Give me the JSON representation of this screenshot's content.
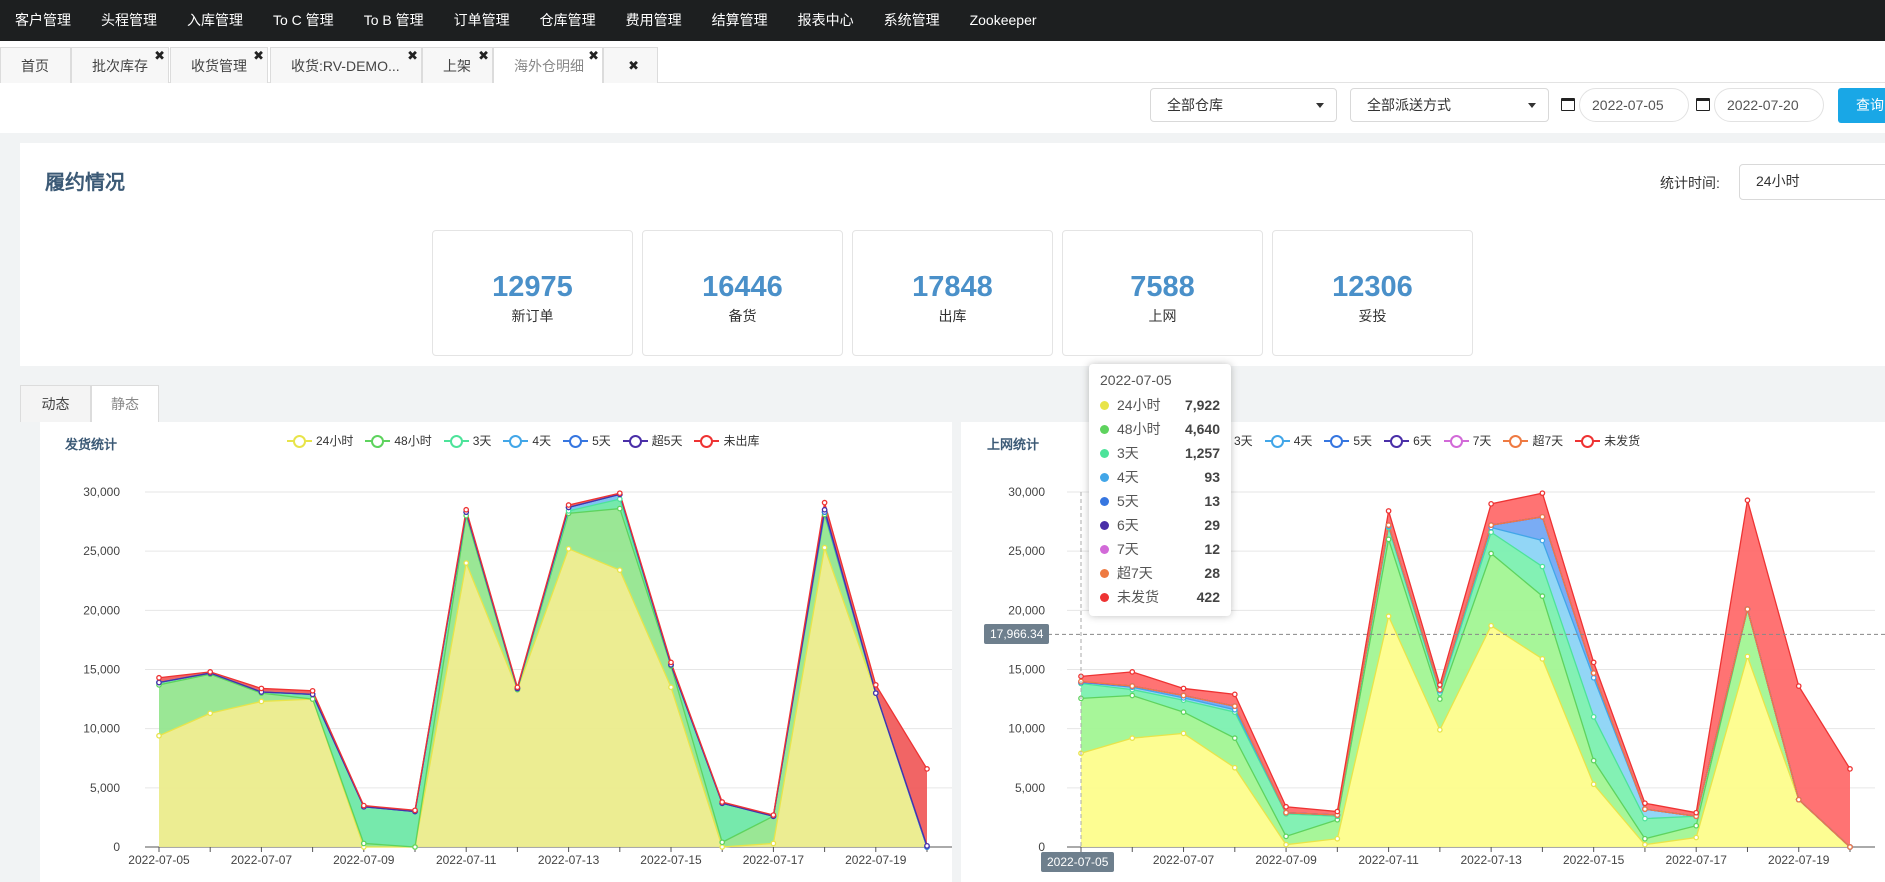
{
  "nav": {
    "items": [
      "客户管理",
      "头程管理",
      "入库管理",
      "To C 管理",
      "To B 管理",
      "订单管理",
      "仓库管理",
      "费用管理",
      "结算管理",
      "报表中心",
      "系统管理",
      "Zookeeper"
    ]
  },
  "tabs": [
    {
      "label": "首页",
      "closable": false
    },
    {
      "label": "批次库存",
      "closable": true
    },
    {
      "label": "收货管理",
      "closable": true
    },
    {
      "label": "收货:RV-DEMO...",
      "closable": true
    },
    {
      "label": "上架",
      "closable": true
    },
    {
      "label": "海外仓明细",
      "closable": true,
      "active": true
    },
    {
      "label": "",
      "closable": true
    }
  ],
  "filters": {
    "warehouse": "全部仓库",
    "delivery": "全部派送方式",
    "date_from": "2022-07-05",
    "date_to": "2022-07-20",
    "query_label": "查询"
  },
  "fulfillment": {
    "title": "履约情况",
    "stat_label": "统计时间:",
    "stat_value": "24小时",
    "cards": [
      {
        "value": "12975",
        "label": "新订单"
      },
      {
        "value": "16446",
        "label": "备货"
      },
      {
        "value": "17848",
        "label": "出库"
      },
      {
        "value": "7588",
        "label": "上网"
      },
      {
        "value": "12306",
        "label": "妥投"
      }
    ]
  },
  "subtabs": [
    "动态",
    "静态"
  ],
  "tooltip": {
    "title": "2022-07-05",
    "rows": [
      {
        "name": "24小时",
        "value": "7,922",
        "color": "#e8e44a"
      },
      {
        "name": "48小时",
        "value": "4,640",
        "color": "#5ed35e"
      },
      {
        "name": "3天",
        "value": "1,257",
        "color": "#4de39a"
      },
      {
        "name": "4天",
        "value": "93",
        "color": "#42a6e8"
      },
      {
        "name": "5天",
        "value": "13",
        "color": "#3676e0"
      },
      {
        "name": "6天",
        "value": "29",
        "color": "#4a2fa8"
      },
      {
        "name": "7天",
        "value": "12",
        "color": "#d26ad8"
      },
      {
        "name": "超7天",
        "value": "28",
        "color": "#ee7a42"
      },
      {
        "name": "未发货",
        "value": "422",
        "color": "#ee3333"
      }
    ]
  },
  "pointer": {
    "y_label": "17,966.34",
    "x_label": "2022-07-05"
  },
  "chart_data": [
    {
      "type": "area",
      "title": "发货统计",
      "x": [
        "2022-07-05",
        "2022-07-06",
        "2022-07-07",
        "2022-07-08",
        "2022-07-09",
        "2022-07-10",
        "2022-07-11",
        "2022-07-12",
        "2022-07-13",
        "2022-07-14",
        "2022-07-15",
        "2022-07-16",
        "2022-07-17",
        "2022-07-18",
        "2022-07-19",
        "2022-07-20"
      ],
      "xticks": [
        "2022-07-05",
        "2022-07-07",
        "2022-07-09",
        "2022-07-11",
        "2022-07-13",
        "2022-07-15",
        "2022-07-17",
        "2022-07-19"
      ],
      "ylim": [
        0,
        30000
      ],
      "yticks": [
        "0",
        "5,000",
        "10,000",
        "15,000",
        "20,000",
        "25,000",
        "30,000"
      ],
      "stacked": true,
      "series": [
        {
          "name": "24小时",
          "color": "#e8e44a",
          "fill": "#ebec8c",
          "values": [
            9400,
            11300,
            12300,
            12500,
            0,
            0,
            24000,
            13300,
            25200,
            23400,
            13500,
            0,
            300,
            25300,
            13000,
            0
          ]
        },
        {
          "name": "48小时",
          "color": "#5ed35e",
          "fill": "#95e68f",
          "values": [
            4300,
            3300,
            700,
            0,
            300,
            0,
            4000,
            0,
            3000,
            5200,
            1800,
            400,
            2300,
            2800,
            0,
            0
          ]
        },
        {
          "name": "3天",
          "color": "#4de39a",
          "fill": "#6fe8a8",
          "values": [
            200,
            100,
            100,
            400,
            3100,
            3000,
            300,
            100,
            200,
            800,
            100,
            3300,
            0,
            200,
            0,
            0
          ]
        },
        {
          "name": "4天",
          "color": "#42a6e8",
          "fill": "#77bff0",
          "values": [
            0,
            0,
            0,
            0,
            0,
            0,
            0,
            0,
            300,
            400,
            0,
            0,
            0,
            0,
            0,
            0
          ]
        },
        {
          "name": "5天",
          "color": "#3676e0",
          "fill": "#7aa6ee",
          "values": [
            0,
            0,
            0,
            0,
            0,
            0,
            0,
            0,
            0,
            0,
            0,
            0,
            0,
            0,
            0,
            0
          ]
        },
        {
          "name": "超5天",
          "color": "#4a2fa8",
          "fill": "#6a53c0",
          "values": [
            0,
            0,
            0,
            0,
            0,
            0,
            0,
            0,
            0,
            0,
            0,
            0,
            0,
            200,
            0,
            100
          ]
        },
        {
          "name": "未出库",
          "color": "#ee3333",
          "fill": "#f05d5d",
          "values": [
            400,
            100,
            300,
            300,
            100,
            100,
            200,
            100,
            200,
            100,
            200,
            100,
            100,
            600,
            700,
            6500
          ]
        }
      ]
    },
    {
      "type": "area",
      "title": "上网统计",
      "x": [
        "2022-07-05",
        "2022-07-06",
        "2022-07-07",
        "2022-07-08",
        "2022-07-09",
        "2022-07-10",
        "2022-07-11",
        "2022-07-12",
        "2022-07-13",
        "2022-07-14",
        "2022-07-15",
        "2022-07-16",
        "2022-07-17",
        "2022-07-18",
        "2022-07-19",
        "2022-07-20"
      ],
      "xticks": [
        "2022-07-05",
        "2022-07-07",
        "2022-07-09",
        "2022-07-11",
        "2022-07-13",
        "2022-07-15",
        "2022-07-17",
        "2022-07-19"
      ],
      "ylim": [
        0,
        30000
      ],
      "yticks": [
        "0",
        "5,000",
        "10,000",
        "15,000",
        "20,000",
        "25,000",
        "30,000"
      ],
      "stacked": true,
      "series": [
        {
          "name": "24小时",
          "color": "#e8e44a",
          "fill": "#fdfd8c",
          "values": [
            7922,
            9200,
            9600,
            6700,
            200,
            700,
            19500,
            9900,
            18700,
            15900,
            5300,
            200,
            800,
            16100,
            4000,
            0
          ]
        },
        {
          "name": "48小时",
          "color": "#5ed35e",
          "fill": "#a2f594",
          "values": [
            4640,
            3600,
            1800,
            2500,
            700,
            1600,
            6500,
            2600,
            6100,
            5300,
            2000,
            500,
            1000,
            4000,
            0,
            0
          ]
        },
        {
          "name": "3天",
          "color": "#4de39a",
          "fill": "#7cf0b0",
          "values": [
            1257,
            500,
            1000,
            2200,
            1900,
            300,
            1000,
            500,
            1800,
            2500,
            3700,
            1700,
            800,
            0,
            0,
            0
          ]
        },
        {
          "name": "4天",
          "color": "#42a6e8",
          "fill": "#8cd4f5",
          "values": [
            93,
            200,
            200,
            200,
            100,
            100,
            100,
            200,
            400,
            2200,
            3300,
            800,
            0,
            0,
            0,
            0
          ]
        },
        {
          "name": "5天",
          "color": "#3676e0",
          "fill": "#73a8f3",
          "values": [
            13,
            100,
            200,
            300,
            0,
            0,
            100,
            100,
            200,
            2000,
            400,
            0,
            0,
            0,
            0,
            0
          ],
          "show_legend": true
        },
        {
          "name": "6天",
          "color": "#4a2fa8",
          "fill": "#7b6fd0",
          "values": [
            29,
            0,
            0,
            0,
            0,
            0,
            0,
            0,
            0,
            0,
            0,
            0,
            0,
            0,
            0,
            0
          ]
        },
        {
          "name": "7天",
          "color": "#d26ad8",
          "fill": "#d79ae0",
          "values": [
            12,
            0,
            0,
            0,
            0,
            0,
            0,
            0,
            0,
            0,
            0,
            0,
            0,
            0,
            0,
            0
          ]
        },
        {
          "name": "超7天",
          "color": "#ee7a42",
          "fill": "#f2a27a",
          "values": [
            28,
            0,
            0,
            0,
            0,
            0,
            0,
            0,
            0,
            0,
            0,
            0,
            0,
            0,
            0,
            0
          ]
        },
        {
          "name": "未发货",
          "color": "#ee3333",
          "fill": "#ff6b6b",
          "values": [
            422,
            1200,
            600,
            1000,
            500,
            300,
            1200,
            400,
            1800,
            2000,
            900,
            500,
            300,
            9200,
            9600,
            6600
          ]
        }
      ]
    }
  ]
}
